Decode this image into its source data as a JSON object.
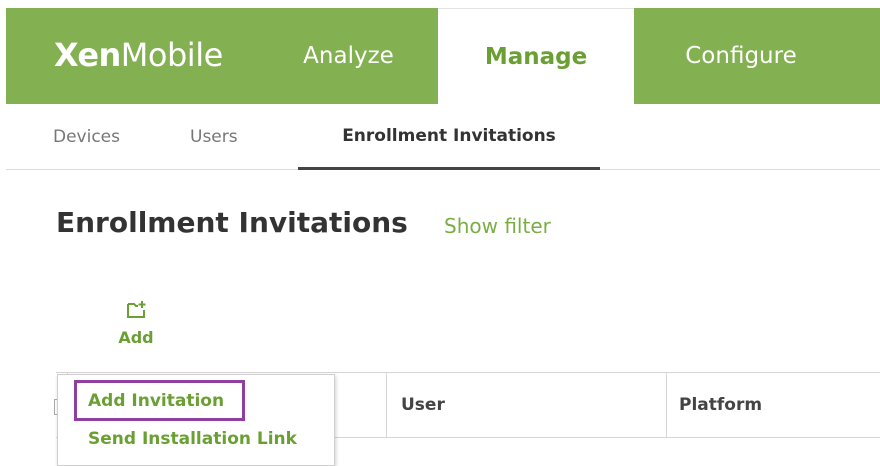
{
  "brand": {
    "bold": "Xen",
    "regular": "Mobile"
  },
  "topnav": {
    "tabs": [
      {
        "label": "Analyze",
        "active": false
      },
      {
        "label": "Manage",
        "active": true
      },
      {
        "label": "Configure",
        "active": false
      }
    ]
  },
  "subnav": {
    "tabs": [
      {
        "label": "Devices",
        "active": false
      },
      {
        "label": "Users",
        "active": false
      },
      {
        "label": "Enrollment Invitations",
        "active": true
      }
    ]
  },
  "page": {
    "title": "Enrollment Invitations",
    "show_filter": "Show filter"
  },
  "toolbar": {
    "add_label": "Add",
    "add_icon": "add-folder-icon"
  },
  "table": {
    "columns": [
      "User",
      "Platform"
    ]
  },
  "add_menu": {
    "items": [
      "Add Invitation",
      "Send Installation Link"
    ],
    "highlighted": "Add Invitation"
  },
  "colors": {
    "brand_green": "#83b050",
    "accent_green": "#6aa033",
    "highlight_purple": "#8e3fa0"
  }
}
